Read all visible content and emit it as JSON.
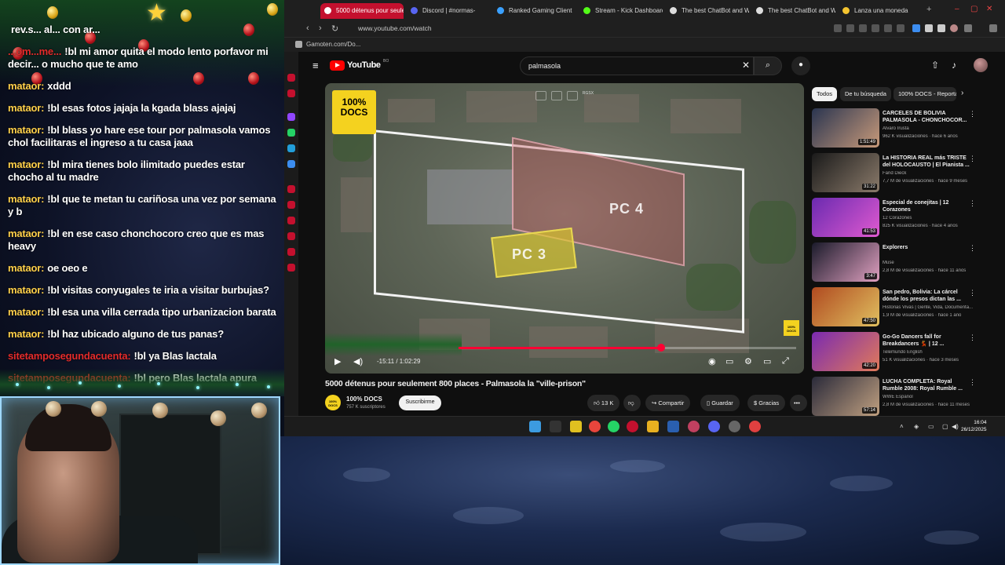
{
  "chat": {
    "messages": [
      {
        "user": "",
        "text": "rev.s... al... con ar...",
        "user_color": "#ffd04a"
      },
      {
        "user": "...om...me...",
        "text": "!bl mi amor quita el modo lento porfavor mi decir... o mucho que te amo",
        "user_color": "#e32b2b"
      },
      {
        "user": "mataor:",
        "text": "xddd",
        "user_color": "#ffd04a"
      },
      {
        "user": "mataor:",
        "text": "!bl esas fotos jajaja la kgada blass ajajaj",
        "user_color": "#ffd04a"
      },
      {
        "user": "mataor:",
        "text": "!bl blass yo hare ese tour por palmasola vamos chol facilitaras el ingreso a tu casa jaaa",
        "user_color": "#ffd04a"
      },
      {
        "user": "mataor:",
        "text": "!bl mira tienes bolo ilimitado puedes estar chocho al tu madre",
        "user_color": "#ffd04a"
      },
      {
        "user": "mataor:",
        "text": "!bl que te metan tu cariñosa una vez por semana y b",
        "user_color": "#ffd04a"
      },
      {
        "user": "mataor:",
        "text": "!bl en ese caso chonchocoro creo que es mas heavy",
        "user_color": "#ffd04a"
      },
      {
        "user": "mataor:",
        "text": "oe oeo e",
        "user_color": "#ffd04a"
      },
      {
        "user": "mataor:",
        "text": "!bl visitas conyugales te iria a visitar burbujas?",
        "user_color": "#ffd04a"
      },
      {
        "user": "mataor:",
        "text": "!bl esa una villa cerrada tipo urbanizacion barata",
        "user_color": "#ffd04a"
      },
      {
        "user": "mataor:",
        "text": "!bl haz ubicado alguno de tus panas?",
        "user_color": "#ffd04a"
      },
      {
        "user": "sitetamposegundacuenta:",
        "text": "!bl ya Blas lactala",
        "user_color": "#e32b2b"
      },
      {
        "user": "sitetamposegundacuenta:",
        "text": "!bl pero Blas lactala apura",
        "user_color": "#e32b2b"
      }
    ]
  },
  "browser": {
    "tabs": [
      {
        "label": "5000 détenus pour seule",
        "active": true,
        "icon_color": "#ff0033"
      },
      {
        "label": "Discord | #normas-",
        "active": false,
        "icon_color": "#5865f2"
      },
      {
        "label": "Ranked Gaming Client",
        "active": false,
        "icon_color": "#3aa0ff"
      },
      {
        "label": "Stream - Kick Dashboard",
        "active": false,
        "icon_color": "#53fc18"
      },
      {
        "label": "The best ChatBot and W",
        "active": false,
        "icon_color": "#dddddd"
      },
      {
        "label": "The best ChatBot and W",
        "active": false,
        "icon_color": "#dddddd"
      },
      {
        "label": "Lanza una moneda",
        "active": false,
        "icon_color": "#f4c430"
      }
    ],
    "new_tab": "+",
    "url": "www.youtube.com/watch",
    "bookmark": "Gamoten.com/Do...",
    "window_controls": [
      "–",
      "▢",
      "✕"
    ]
  },
  "youtube": {
    "brand": "YouTube",
    "country_code": "BO",
    "search_query": "palmasola",
    "video": {
      "title": "5000 détenus pour seulement 800 places - Palmasola la \"ville-prison\"",
      "time": "-15:11 / 1:02:29",
      "progress": 0.6,
      "overlay_logo": "100% DOCS",
      "zone_a": "PC 4",
      "zone_b": "PC 3",
      "top_badge": "RGSX"
    },
    "channel": {
      "name": "100% DOCS",
      "subs": "757 K suscriptores",
      "avatar_text": "100% DOCS",
      "subscribe": "Suscribirme"
    },
    "actions": {
      "likes": "13 K",
      "share": "Compartir",
      "save": "Guardar",
      "thanks": "Gracias",
      "more": "•••"
    },
    "chips": [
      "Todos",
      "De tu búsqueda",
      "100% DOCS - Reporta"
    ],
    "recommendations": [
      {
        "title": "CARCELES DE BOLIVIA PALMASOLA - CHONCHOCOR...",
        "channel": "Alvaro Irusta",
        "meta": "962 K visualizaciones · hace 6 años",
        "duration": "1:51:49",
        "colors": [
          "#2a3550",
          "#c89a7a"
        ]
      },
      {
        "title": "La HISTORIA REAL más TRISTE del HOLOCAUSTO | El Pianista ...",
        "channel": "Farid Dieck",
        "meta": "7,7 M de visualizaciones · hace 9 meses",
        "duration": "31:22",
        "colors": [
          "#1a1a1a",
          "#8a7a6a"
        ]
      },
      {
        "title": "Especial de conejitas | 12 Corazones",
        "channel": "12 Corazones",
        "meta": "825 K visualizaciones · hace 4 años",
        "duration": "41:53",
        "colors": [
          "#6a2ab0",
          "#e05ad0"
        ]
      },
      {
        "title": "Explorers",
        "channel": "Muse",
        "meta": "2,8 M de visualizaciones · hace 11 años",
        "duration": "3:47",
        "colors": [
          "#1a1a2a",
          "#e0a0c0"
        ]
      },
      {
        "title": "San pedro, Bolivia: La cárcel dónde los presos dictan las ...",
        "channel": "Historias Vivas | Gente, Vida, Documenta...",
        "meta": "1,9 M de visualizaciones · hace 1 año",
        "duration": "47:50",
        "colors": [
          "#b04a20",
          "#e0c060"
        ]
      },
      {
        "title": "Go-Go Dancers fall for Breakdancers 💃 | 12 ...",
        "channel": "Telemundo English",
        "meta": "51 K visualizaciones · hace 3 meses",
        "duration": "42:20",
        "colors": [
          "#7a2ab0",
          "#e07a5a"
        ]
      },
      {
        "title": "LUCHA COMPLETA: Royal Rumble 2008: Royal Rumble ...",
        "channel": "WWE Español",
        "meta": "2,8 M de visualizaciones · hace 11 meses",
        "duration": "57:14",
        "colors": [
          "#2a2a3a",
          "#c0a080"
        ]
      }
    ]
  },
  "taskbar": {
    "clock_time": "16:04",
    "clock_date": "26/12/2025"
  }
}
